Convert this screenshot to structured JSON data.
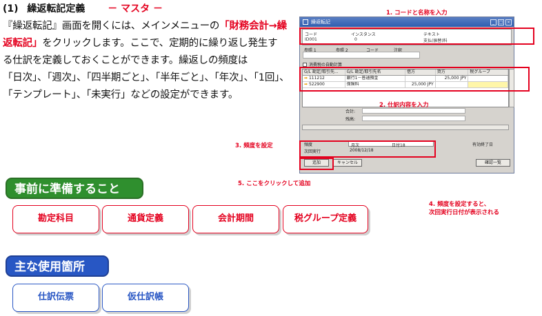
{
  "heading": {
    "number": "(1)",
    "title": "繰返転記定義",
    "subtitle": "－ マスタ －"
  },
  "paragraph": {
    "l1a": "『繰返転記』画面を開くには、メインメニューの",
    "l1link": "「財務会計→繰",
    "l2link": "返転記」",
    "l2b": "をクリックします。ここで、定期的に繰り返し発生す",
    "l3": "る仕訳を定義しておくことができます。繰返しの頻度は",
    "l4": "「日次」、「週次」、「四半期ごと」、「半年ごと」、「年次」、「1回」、",
    "l5": "「テンプレート」、「未実行」などの設定ができます。"
  },
  "window": {
    "title": "繰返転記",
    "header_labels": [
      "コード",
      "インスタンス",
      "テキスト"
    ],
    "header_values": [
      "ID001",
      "0",
      "支払(振替)料"
    ],
    "ref_labels": [
      "参照 1",
      "参照 2",
      "コード",
      "注釈"
    ],
    "auto_calc": "消費税の自動計算",
    "columns": [
      "G/L 勘定/取引先...",
      "G/L 勘定/取引先名",
      "借方",
      "貸方",
      "税グループ"
    ],
    "rows": [
      {
        "code": "111212",
        "name": "銀行1－普通預金",
        "debit": "",
        "credit": "25,000 JPY",
        "tax": ""
      },
      {
        "code": "522900",
        "name": "保険料",
        "debit": "25,000 JPY",
        "credit": "",
        "tax": ""
      }
    ],
    "totals": [
      "合計:",
      "残高:"
    ],
    "freq_label": "頻度",
    "freq_value": "月次",
    "day_value": "日付18",
    "next_label": "次回実行",
    "next_value": "2008/12/18",
    "valid_label": "有効終了日",
    "add_button": "追加",
    "cancel_button": "キャンセル",
    "list_button": "確認一覧"
  },
  "annotations": {
    "a1": "1. コードと名称を入力",
    "a2": "2. 仕訳内容を入力",
    "a3": "3. 頻度を設定",
    "a4l1": "4. 頻度を設定すると、",
    "a4l2": "次回実行日付が表示される",
    "a5": "5. ここをクリックして追加"
  },
  "sections": {
    "prep_title": "事前に準備すること",
    "prep_items": [
      "勘定科目",
      "通貨定義",
      "会計期間",
      "税グループ定義"
    ],
    "usage_title": "主な使用箇所",
    "usage_items": [
      "仕訳伝票",
      "仮仕訳帳"
    ]
  },
  "colors": {
    "accent_red": "#e4001e",
    "green": "#2f8f2e",
    "blue": "#2857c4"
  }
}
